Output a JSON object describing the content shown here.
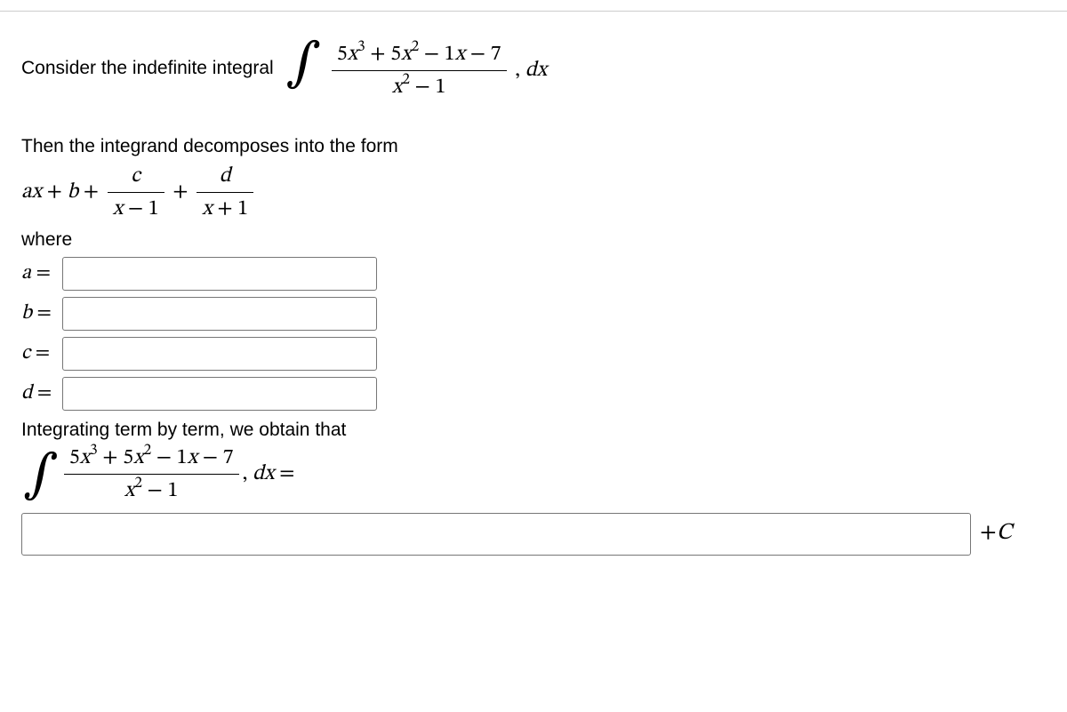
{
  "problem": {
    "intro_text": "Consider the indefinite integral",
    "numerator_html": "5x³ + 5x² − 1x − 7",
    "denominator_html": "x² − 1",
    "dx": ", dx",
    "decompose_text": "Then the integrand decomposes into the form",
    "decomp_lhs": "ax + b +",
    "frac1_num": "c",
    "frac1_den": "x − 1",
    "plus": "+",
    "frac2_num": "d",
    "frac2_den": "x + 1",
    "where": "where",
    "labels": {
      "a": "a =",
      "b": "b =",
      "c": "c =",
      "d": "d ="
    },
    "integrating_text": "Integrating term by term, we obtain that",
    "equals": "=",
    "plus_C": "+C"
  }
}
